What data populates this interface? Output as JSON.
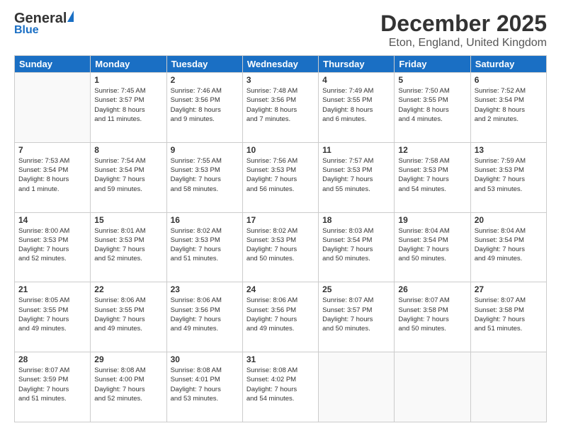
{
  "header": {
    "logo_line1": "General",
    "logo_triangle": "▲",
    "logo_line2": "Blue",
    "title": "December 2025",
    "subtitle": "Eton, England, United Kingdom"
  },
  "days_of_week": [
    "Sunday",
    "Monday",
    "Tuesday",
    "Wednesday",
    "Thursday",
    "Friday",
    "Saturday"
  ],
  "weeks": [
    [
      {
        "num": "",
        "info": ""
      },
      {
        "num": "1",
        "info": "Sunrise: 7:45 AM\nSunset: 3:57 PM\nDaylight: 8 hours\nand 11 minutes."
      },
      {
        "num": "2",
        "info": "Sunrise: 7:46 AM\nSunset: 3:56 PM\nDaylight: 8 hours\nand 9 minutes."
      },
      {
        "num": "3",
        "info": "Sunrise: 7:48 AM\nSunset: 3:56 PM\nDaylight: 8 hours\nand 7 minutes."
      },
      {
        "num": "4",
        "info": "Sunrise: 7:49 AM\nSunset: 3:55 PM\nDaylight: 8 hours\nand 6 minutes."
      },
      {
        "num": "5",
        "info": "Sunrise: 7:50 AM\nSunset: 3:55 PM\nDaylight: 8 hours\nand 4 minutes."
      },
      {
        "num": "6",
        "info": "Sunrise: 7:52 AM\nSunset: 3:54 PM\nDaylight: 8 hours\nand 2 minutes."
      }
    ],
    [
      {
        "num": "7",
        "info": "Sunrise: 7:53 AM\nSunset: 3:54 PM\nDaylight: 8 hours\nand 1 minute."
      },
      {
        "num": "8",
        "info": "Sunrise: 7:54 AM\nSunset: 3:54 PM\nDaylight: 7 hours\nand 59 minutes."
      },
      {
        "num": "9",
        "info": "Sunrise: 7:55 AM\nSunset: 3:53 PM\nDaylight: 7 hours\nand 58 minutes."
      },
      {
        "num": "10",
        "info": "Sunrise: 7:56 AM\nSunset: 3:53 PM\nDaylight: 7 hours\nand 56 minutes."
      },
      {
        "num": "11",
        "info": "Sunrise: 7:57 AM\nSunset: 3:53 PM\nDaylight: 7 hours\nand 55 minutes."
      },
      {
        "num": "12",
        "info": "Sunrise: 7:58 AM\nSunset: 3:53 PM\nDaylight: 7 hours\nand 54 minutes."
      },
      {
        "num": "13",
        "info": "Sunrise: 7:59 AM\nSunset: 3:53 PM\nDaylight: 7 hours\nand 53 minutes."
      }
    ],
    [
      {
        "num": "14",
        "info": "Sunrise: 8:00 AM\nSunset: 3:53 PM\nDaylight: 7 hours\nand 52 minutes."
      },
      {
        "num": "15",
        "info": "Sunrise: 8:01 AM\nSunset: 3:53 PM\nDaylight: 7 hours\nand 52 minutes."
      },
      {
        "num": "16",
        "info": "Sunrise: 8:02 AM\nSunset: 3:53 PM\nDaylight: 7 hours\nand 51 minutes."
      },
      {
        "num": "17",
        "info": "Sunrise: 8:02 AM\nSunset: 3:53 PM\nDaylight: 7 hours\nand 50 minutes."
      },
      {
        "num": "18",
        "info": "Sunrise: 8:03 AM\nSunset: 3:54 PM\nDaylight: 7 hours\nand 50 minutes."
      },
      {
        "num": "19",
        "info": "Sunrise: 8:04 AM\nSunset: 3:54 PM\nDaylight: 7 hours\nand 50 minutes."
      },
      {
        "num": "20",
        "info": "Sunrise: 8:04 AM\nSunset: 3:54 PM\nDaylight: 7 hours\nand 49 minutes."
      }
    ],
    [
      {
        "num": "21",
        "info": "Sunrise: 8:05 AM\nSunset: 3:55 PM\nDaylight: 7 hours\nand 49 minutes."
      },
      {
        "num": "22",
        "info": "Sunrise: 8:06 AM\nSunset: 3:55 PM\nDaylight: 7 hours\nand 49 minutes."
      },
      {
        "num": "23",
        "info": "Sunrise: 8:06 AM\nSunset: 3:56 PM\nDaylight: 7 hours\nand 49 minutes."
      },
      {
        "num": "24",
        "info": "Sunrise: 8:06 AM\nSunset: 3:56 PM\nDaylight: 7 hours\nand 49 minutes."
      },
      {
        "num": "25",
        "info": "Sunrise: 8:07 AM\nSunset: 3:57 PM\nDaylight: 7 hours\nand 50 minutes."
      },
      {
        "num": "26",
        "info": "Sunrise: 8:07 AM\nSunset: 3:58 PM\nDaylight: 7 hours\nand 50 minutes."
      },
      {
        "num": "27",
        "info": "Sunrise: 8:07 AM\nSunset: 3:58 PM\nDaylight: 7 hours\nand 51 minutes."
      }
    ],
    [
      {
        "num": "28",
        "info": "Sunrise: 8:07 AM\nSunset: 3:59 PM\nDaylight: 7 hours\nand 51 minutes."
      },
      {
        "num": "29",
        "info": "Sunrise: 8:08 AM\nSunset: 4:00 PM\nDaylight: 7 hours\nand 52 minutes."
      },
      {
        "num": "30",
        "info": "Sunrise: 8:08 AM\nSunset: 4:01 PM\nDaylight: 7 hours\nand 53 minutes."
      },
      {
        "num": "31",
        "info": "Sunrise: 8:08 AM\nSunset: 4:02 PM\nDaylight: 7 hours\nand 54 minutes."
      },
      {
        "num": "",
        "info": ""
      },
      {
        "num": "",
        "info": ""
      },
      {
        "num": "",
        "info": ""
      }
    ]
  ]
}
